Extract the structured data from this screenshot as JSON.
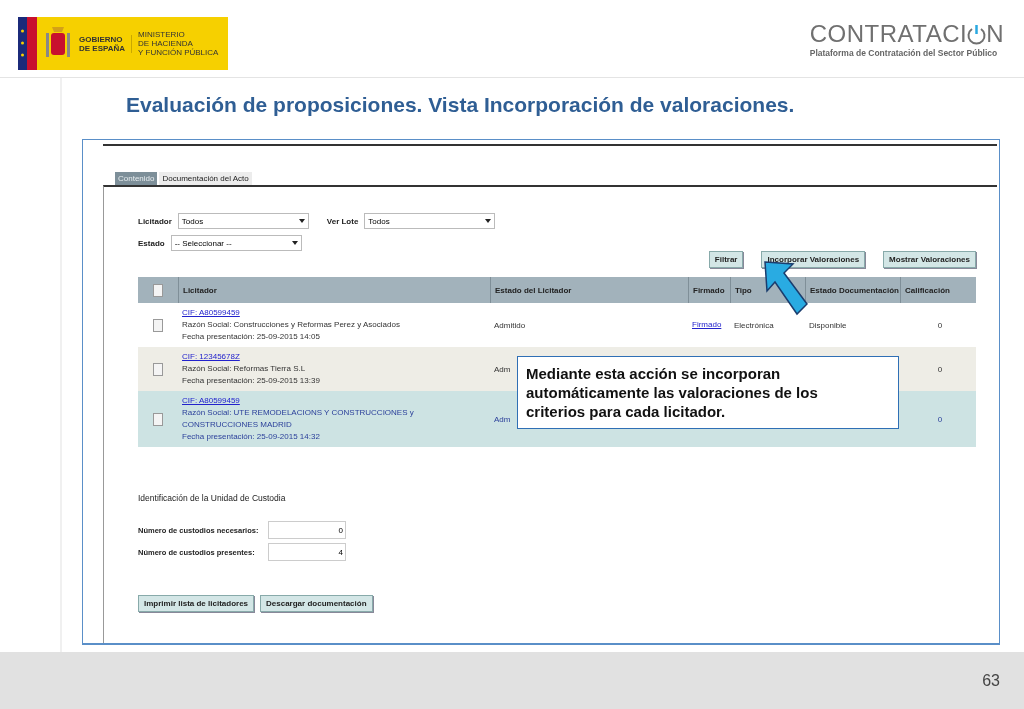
{
  "header": {
    "gov_logo": {
      "line_1": "GOBIERNO",
      "line_2": "DE ESPAÑA",
      "ministry_1": "MINISTERIO",
      "ministry_2": "DE HACIENDA",
      "ministry_3": "Y FUNCIÓN PÚBLICA"
    },
    "brand": {
      "name_start": "CONTRATACI",
      "name_end": "N",
      "subtitle": "Plataforma de Contratación del Sector Público"
    }
  },
  "title": "Evaluación de proposiciones. Vista Incorporación de valoraciones.",
  "tabs": [
    {
      "label": "Contenido",
      "selected": true
    },
    {
      "label": "Documentación del Acto",
      "selected": false
    }
  ],
  "filters": {
    "licitador": {
      "label": "Licitador",
      "value": "Todos"
    },
    "lote": {
      "label": "Ver Lote",
      "value": "Todos"
    },
    "estado": {
      "label": "Estado",
      "value": "-- Seleccionar --"
    }
  },
  "actions": [
    "Filtrar",
    "Incorporar Valoraciones",
    "Mostrar Valoraciones"
  ],
  "table": {
    "columns": [
      "Licitador",
      "Estado del Licitador",
      "Firmado",
      "Tipo",
      "Estado Documentación",
      "Calificación"
    ],
    "header_checked": false,
    "rows": [
      {
        "selected": false,
        "checked": false,
        "cif": "CIF: A80599459",
        "razon": "Razón Social: Construcciones y Reformas Perez y Asociados",
        "fecha": "Fecha presentación: 25-09-2015 14:05",
        "estado": "Admitido",
        "firmado": "Firmado",
        "tipo": "Electrónica",
        "estado_doc": "Disponible",
        "calificacion": "0"
      },
      {
        "selected": false,
        "checked": false,
        "cif": "CIF: 12345678Z",
        "razon": "Razón Social: Reformas Tierra S.L",
        "fecha": "Fecha presentación: 25-09-2015 13:39",
        "estado": "Adm",
        "calificacion": "0"
      },
      {
        "selected": true,
        "checked": false,
        "cif": "CIF: A80599459",
        "razon": "Razón Social: UTE REMODELACIONS Y CONSTRUCCIONES y CONSTRUCCIONES MADRID",
        "fecha": "Fecha presentación: 25-09-2015 14:32",
        "estado": "Adm",
        "calificacion": "0"
      }
    ]
  },
  "custody": {
    "title": "Identificación de la Unidad de Custodia",
    "fields": [
      {
        "label": "Número de custodios necesarios:",
        "value": "0"
      },
      {
        "label": "Número de custodios presentes:",
        "value": "4"
      }
    ]
  },
  "bottom_buttons": [
    "Imprimir lista de licitadores",
    "Descargar documentación"
  ],
  "callout": "Mediante esta acción se incorporan automáticamente las valoraciones de los criterios para cada licitador.",
  "page_number": "63"
}
